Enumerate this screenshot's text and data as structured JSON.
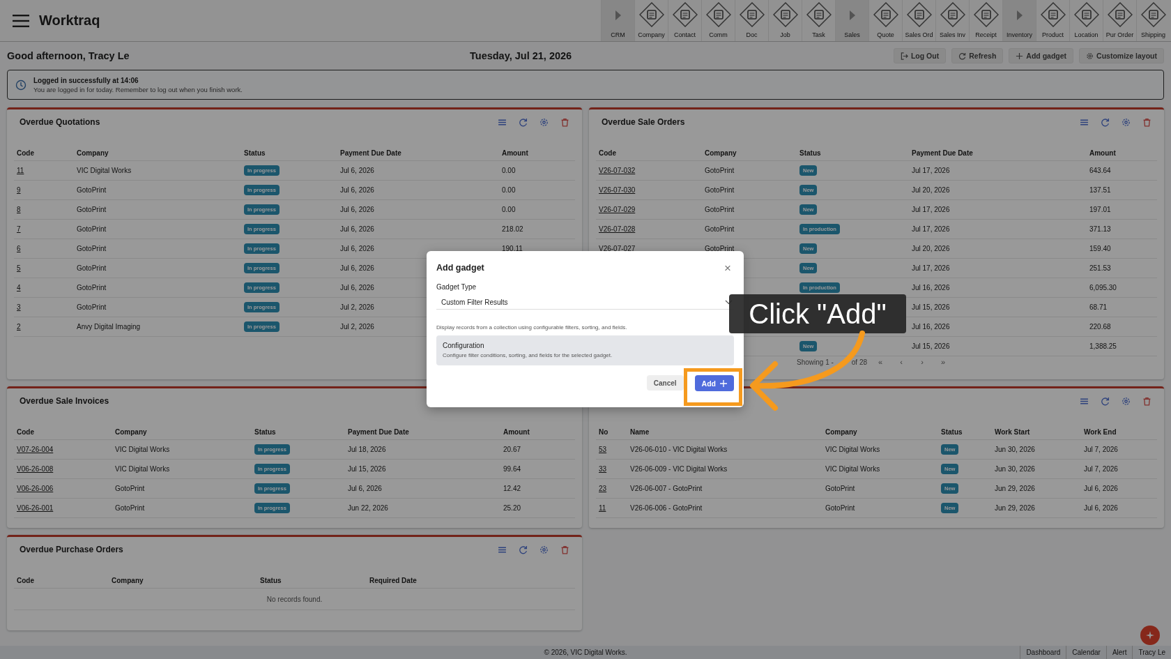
{
  "app": {
    "title": "Worktraq"
  },
  "nav": [
    {
      "label": "CRM",
      "kind": "section"
    },
    {
      "label": "Company",
      "kind": "app"
    },
    {
      "label": "Contact",
      "kind": "app"
    },
    {
      "label": "Comm",
      "kind": "app"
    },
    {
      "label": "Doc",
      "kind": "app"
    },
    {
      "label": "Job",
      "kind": "app"
    },
    {
      "label": "Task",
      "kind": "app"
    },
    {
      "label": "Sales",
      "kind": "section"
    },
    {
      "label": "Quote",
      "kind": "app"
    },
    {
      "label": "Sales Ord",
      "kind": "app"
    },
    {
      "label": "Sales Inv",
      "kind": "app"
    },
    {
      "label": "Receipt",
      "kind": "app"
    },
    {
      "label": "Inventory",
      "kind": "section"
    },
    {
      "label": "Product",
      "kind": "app"
    },
    {
      "label": "Location",
      "kind": "app"
    },
    {
      "label": "Pur Order",
      "kind": "app"
    },
    {
      "label": "Shipping",
      "kind": "app"
    }
  ],
  "greeting": "Good afternoon, Tracy Le",
  "date": "Tuesday, Jul 21, 2026",
  "actions": [
    {
      "label": "Log Out",
      "kind": "logout"
    },
    {
      "label": "Refresh",
      "kind": "refresh"
    },
    {
      "label": "Add gadget",
      "kind": "add"
    },
    {
      "label": "Customize layout",
      "kind": "settings"
    }
  ],
  "alert": {
    "title": "Logged in successfully at 14:06",
    "message": "You are logged in for today. Remember to log out when you finish work."
  },
  "panels": [
    {
      "title": "Overdue Quotations",
      "tools": true,
      "columns": [
        {
          "label": "Code",
          "kind": "link"
        },
        {
          "label": "Company",
          "kind": "text"
        },
        {
          "label": "Status",
          "kind": "badge"
        },
        {
          "label": "Payment Due Date",
          "kind": "text"
        },
        {
          "label": "Amount",
          "kind": "text"
        }
      ],
      "rows": [
        {
          "code": "11",
          "company": "VIC Digital Works",
          "status": "In progress",
          "due": "Jul 6, 2026",
          "amount": "0.00"
        },
        {
          "code": "9",
          "company": "GotoPrint",
          "status": "In progress",
          "due": "Jul 6, 2026",
          "amount": "0.00"
        },
        {
          "code": "8",
          "company": "GotoPrint",
          "status": "In progress",
          "due": "Jul 6, 2026",
          "amount": "0.00"
        },
        {
          "code": "7",
          "company": "GotoPrint",
          "status": "In progress",
          "due": "Jul 6, 2026",
          "amount": "218.02"
        },
        {
          "code": "6",
          "company": "GotoPrint",
          "status": "In progress",
          "due": "Jul 6, 2026",
          "amount": "190.11"
        },
        {
          "code": "5",
          "company": "GotoPrint",
          "status": "In progress",
          "due": "Jul 6, 2026"
        },
        {
          "code": "4",
          "company": "GotoPrint",
          "status": "In progress",
          "due": "Jul 6, 2026"
        },
        {
          "code": "3",
          "company": "GotoPrint",
          "status": "In progress",
          "due": "Jul 2, 2026"
        },
        {
          "code": "2",
          "company": "Anvy Digital Imaging",
          "status": "In progress",
          "due": "Jul 2, 2026"
        }
      ]
    },
    {
      "title": "Overdue Sale Orders",
      "tools": true,
      "columns": [
        {
          "label": "Code",
          "kind": "link"
        },
        {
          "label": "Company",
          "kind": "text"
        },
        {
          "label": "Status",
          "kind": "badge"
        },
        {
          "label": "Payment Due Date",
          "kind": "text"
        },
        {
          "label": "Amount",
          "kind": "text"
        }
      ],
      "rows": [
        {
          "code": "V26-07-032",
          "company": "GotoPrint",
          "status": "New",
          "due": "Jul 17, 2026",
          "amount": "643.64"
        },
        {
          "code": "V26-07-030",
          "company": "GotoPrint",
          "status": "New",
          "due": "Jul 20, 2026",
          "amount": "137.51"
        },
        {
          "code": "V26-07-029",
          "company": "GotoPrint",
          "status": "New",
          "due": "Jul 17, 2026",
          "amount": "197.01"
        },
        {
          "code": "V26-07-028",
          "company": "GotoPrint",
          "status": "In production",
          "due": "Jul 17, 2026",
          "amount": "371.13"
        },
        {
          "code": "V26-07-027",
          "company": "GotoPrint",
          "status": "New",
          "due": "Jul 20, 2026",
          "amount": "159.40"
        },
        {
          "status": "New",
          "due": "Jul 17, 2026",
          "amount": "251.53"
        },
        {
          "status": "In production",
          "due": "Jul 16, 2026",
          "amount": "6,095.30"
        },
        {
          "due": "Jul 15, 2026",
          "amount": "68.71"
        },
        {
          "due": "Jul 16, 2026",
          "amount": "220.68"
        },
        {
          "status": "New",
          "due": "Jul 15, 2026",
          "amount": "1,388.25"
        }
      ],
      "pagination": {
        "text_start": "Showing 1 -",
        "text_end": "of 28",
        "controls": [
          "«",
          "‹",
          "›",
          "»"
        ]
      }
    },
    {
      "title": "Overdue Sale Invoices",
      "columns": [
        {
          "label": "Code",
          "kind": "link"
        },
        {
          "label": "Company",
          "kind": "text"
        },
        {
          "label": "Status",
          "kind": "badge"
        },
        {
          "label": "Payment Due Date",
          "kind": "text"
        },
        {
          "label": "Amount",
          "kind": "text"
        }
      ],
      "rows": [
        {
          "code": "V07-26-004",
          "company": "VIC Digital Works",
          "status": "In progress",
          "due": "Jul 18, 2026",
          "amount": "20.67"
        },
        {
          "code": "V06-26-008",
          "company": "VIC Digital Works",
          "status": "In progress",
          "due": "Jul 15, 2026",
          "amount": "99.64"
        },
        {
          "code": "V06-26-006",
          "company": "GotoPrint",
          "status": "In progress",
          "due": "Jul 6, 2026",
          "amount": "12.42"
        },
        {
          "code": "V06-26-001",
          "company": "GotoPrint",
          "status": "In progress",
          "due": "Jun 22, 2026",
          "amount": "25.20"
        }
      ]
    },
    {
      "tools": true,
      "columns": [
        {
          "label": "No",
          "kind": "link"
        },
        {
          "label": "Name",
          "kind": "text"
        },
        {
          "label": "Company",
          "kind": "text"
        },
        {
          "label": "Status",
          "kind": "badge"
        },
        {
          "label": "Work Start",
          "kind": "text"
        },
        {
          "label": "Work End",
          "kind": "text"
        }
      ],
      "rows": [
        {
          "no": "53",
          "name": "V26-06-010 - VIC Digital Works",
          "company": "VIC Digital Works",
          "status": "New",
          "start": "Jun 30, 2026",
          "end": "Jul 7, 2026"
        },
        {
          "no": "33",
          "name": "V26-06-009 - VIC Digital Works",
          "company": "VIC Digital Works",
          "status": "New",
          "start": "Jun 30, 2026",
          "end": "Jul 7, 2026"
        },
        {
          "no": "23",
          "name": "V26-06-007 - GotoPrint",
          "company": "GotoPrint",
          "status": "New",
          "start": "Jun 29, 2026",
          "end": "Jul 6, 2026"
        },
        {
          "no": "11",
          "name": "V26-06-006 - GotoPrint",
          "company": "GotoPrint",
          "status": "New",
          "start": "Jun 29, 2026",
          "end": "Jul 6, 2026"
        }
      ]
    },
    {
      "title": "Overdue Purchase Orders",
      "tools": true,
      "columns": [
        {
          "label": "Code"
        },
        {
          "label": "Company"
        },
        {
          "label": "Status"
        },
        {
          "label": "Required Date"
        }
      ],
      "empty_text": "No records found."
    }
  ],
  "footer": {
    "copyright": "© 2026, VIC Digital Works.",
    "links": [
      "Dashboard",
      "Calendar",
      "Alert",
      "Tracy Le"
    ]
  },
  "modal": {
    "title": "Add gadget",
    "close": "×",
    "field_label": "Gadget Type",
    "value": "Custom Filter Results",
    "description": "Display records from a collection using configurable filters, sorting, and fields.",
    "section": {
      "title": "Configuration",
      "text": "Configure filter conditions, sorting, and fields for the selected gadget."
    },
    "cancel": "Cancel",
    "confirm": "Add"
  },
  "annotation": {
    "callout": "Click \"Add\""
  }
}
